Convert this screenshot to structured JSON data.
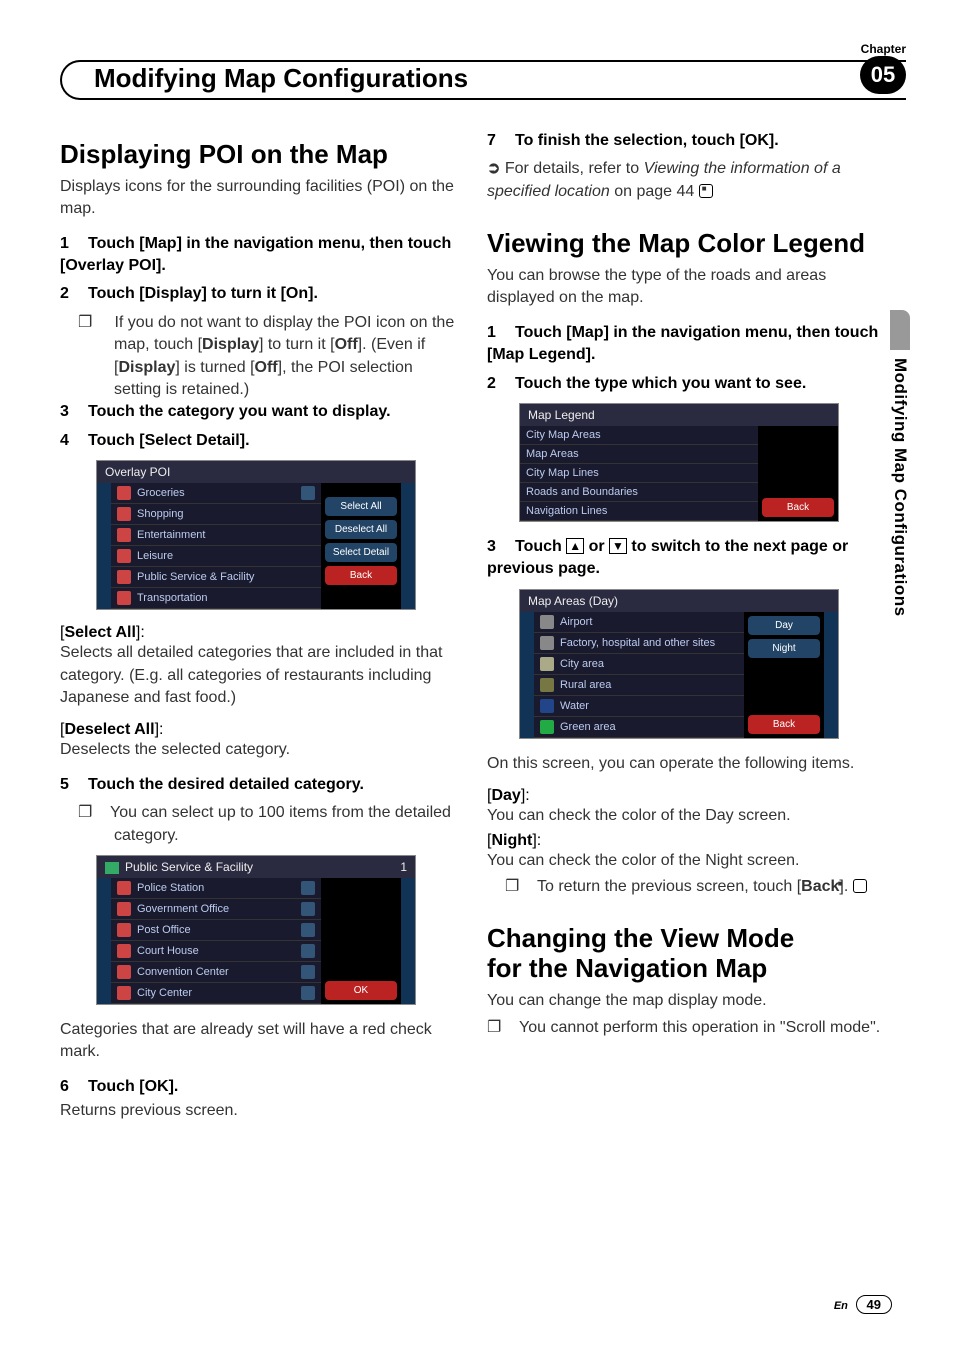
{
  "chapterLabel": "Chapter",
  "chapterNum": "05",
  "headerTitle": "Modifying Map Configurations",
  "sideTab": "Modifying Map Configurations",
  "footer": {
    "en": "En",
    "page": "49"
  },
  "left": {
    "h1": "Displaying POI on the Map",
    "intro": "Displays icons for the surrounding facilities (POI) on the map.",
    "step1n": "1",
    "step1t": "Touch [Map] in the navigation menu, then touch [Overlay POI].",
    "step2n": "2",
    "step2t": "Touch [Display] to turn it [On].",
    "step2s1a": "If you do not want to display the POI icon on the map, touch [",
    "step2s1b": "Display",
    "step2s1c": "] to turn it [",
    "step2s1d": "Off",
    "step2s1e": "]. (Even if [",
    "step2s1f": "Display",
    "step2s1g": "] is turned [",
    "step2s1h": "Off",
    "step2s1i": "], the POI selection setting is retained.)",
    "step3n": "3",
    "step3t": "Touch the category you want to display.",
    "step4n": "4",
    "step4t": "Touch [Select Detail].",
    "ss1": {
      "title": "Overlay POI",
      "rows": [
        "Groceries",
        "Shopping",
        "Entertainment",
        "Leisure",
        "Public Service & Facility",
        "Transportation"
      ],
      "btns": [
        "Select All",
        "Deselect All",
        "Select Detail",
        "Back"
      ]
    },
    "selAllLabel": "Select All",
    "selAllTxt": "Selects all detailed categories that are included in that category. (E.g. all categories of restaurants including Japanese and fast food.)",
    "deselLabel": "Deselect All",
    "deselTxt": "Deselects the selected category.",
    "step5n": "5",
    "step5t": "Touch the desired detailed category.",
    "step5s": "You can select up to 100 items from the detailed category.",
    "ss2": {
      "title": "Public Service & Facility",
      "count": "1",
      "rows": [
        "Police Station",
        "Government Office",
        "Post Office",
        "Court House",
        "Convention Center",
        "City Center"
      ],
      "ok": "OK"
    },
    "catNote": "Categories that are already set will have a red check mark.",
    "step6n": "6",
    "step6t": "Touch [OK].",
    "step6s": "Returns previous screen."
  },
  "right": {
    "step7n": "7",
    "step7t": "To finish the selection, touch [OK].",
    "refA": "For details, refer to ",
    "refItal": "Viewing the information of a specified location",
    "refB": " on page 44",
    "h2": "Viewing the Map Color Legend",
    "intro2": "You can browse the type of the roads and areas displayed on the map.",
    "r1n": "1",
    "r1t": "Touch [Map] in the navigation menu, then touch [Map Legend].",
    "r2n": "2",
    "r2t": "Touch the type which you want to see.",
    "ss3": {
      "title": "Map Legend",
      "rows": [
        "City Map Areas",
        "Map Areas",
        "City Map Lines",
        "Roads and Boundaries",
        "Navigation Lines"
      ],
      "back": "Back"
    },
    "r3n": "3",
    "r3tA": "Touch ",
    "r3tB": " or ",
    "r3tC": " to switch to the next page or previous page.",
    "ss4": {
      "title": "Map Areas (Day)",
      "rows": [
        "Airport",
        "Factory, hospital and other sites",
        "City area",
        "Rural area",
        "Water",
        "Green area"
      ],
      "btns": [
        "Day",
        "Night",
        "Back"
      ]
    },
    "opNote": "On this screen, you can operate the following items.",
    "dayLabel": "Day",
    "dayTxt": "You can check the color of the Day screen.",
    "nightLabel": "Night",
    "nightTxt": "You can check the color of the Night screen.",
    "backSubA": "To return the previous screen, touch [",
    "backSubB": "Back",
    "backSubC": "].",
    "h3a": "Changing the View Mode",
    "h3b": "for the Navigation Map",
    "intro3": "You can change the map display mode.",
    "note3": "You cannot perform this operation in \"Scroll mode\"."
  }
}
